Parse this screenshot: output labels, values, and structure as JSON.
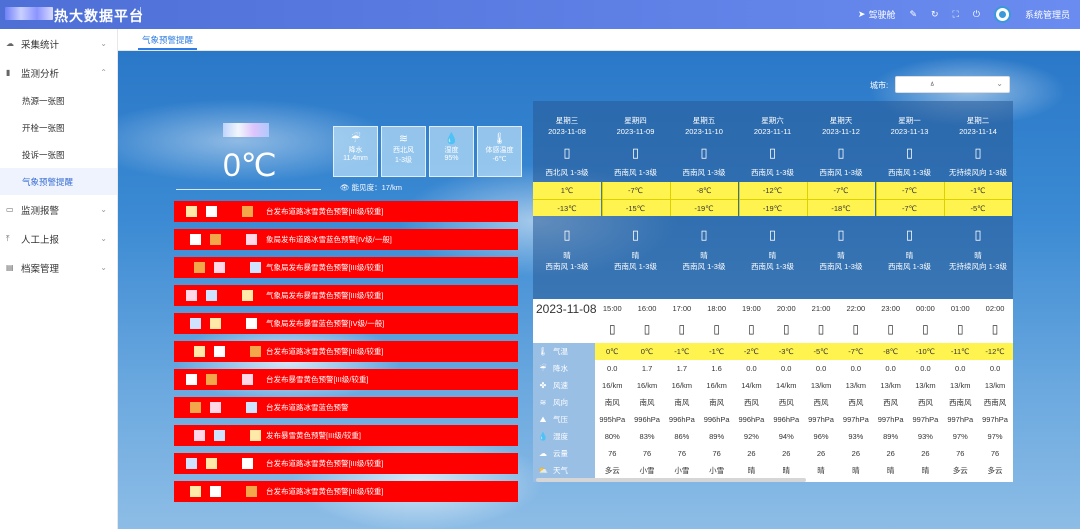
{
  "header": {
    "title": "热大数据平台",
    "actions": [
      {
        "icon": "send-icon",
        "label": "驾驶舱"
      },
      {
        "icon": "edit-icon",
        "label": ""
      },
      {
        "icon": "refresh-icon",
        "label": ""
      },
      {
        "icon": "fullscreen-icon",
        "label": ""
      },
      {
        "icon": "power-icon",
        "label": ""
      }
    ],
    "user": "系统管理员"
  },
  "sidebar": {
    "groups": [
      {
        "label": "采集统计",
        "icon": "cloud-icon",
        "expanded": false
      },
      {
        "label": "监测分析",
        "icon": "bar-chart-icon",
        "expanded": true,
        "items": [
          "热源一张图",
          "开栓一张图",
          "投诉一张图",
          "气象预警提醒"
        ]
      },
      {
        "label": "监测报警",
        "icon": "monitor-icon",
        "expanded": false
      },
      {
        "label": "人工上报",
        "icon": "upload-icon",
        "expanded": false
      },
      {
        "label": "档案管理",
        "icon": "archive-icon",
        "expanded": false
      }
    ],
    "active_item": "气象预警提醒"
  },
  "tabs": [
    "气象预警提醒"
  ],
  "city": {
    "label": "城市:",
    "value": "ㅿ"
  },
  "current": {
    "temp": "0℃",
    "cards": [
      {
        "icon": "rain-icon",
        "label": "降水",
        "value": "11.4mm"
      },
      {
        "icon": "wind-icon",
        "label": "西北风",
        "value": "1-3级"
      },
      {
        "icon": "humidity-icon",
        "label": "湿度",
        "value": "95%"
      },
      {
        "icon": "thermometer-icon",
        "label": "体感温度",
        "value": "-6℃"
      }
    ],
    "visibility": "能见度：17/km"
  },
  "alerts": [
    "台发布道路冰雪黄色预警[III级/较重]",
    "象局发布道路冰雪蓝色预警[IV级/一般]",
    "气象局发布暴雪黄色预警[III级/较重]",
    "气象局发布暴雪黄色预警[III级/较重]",
    "气象局发布暴雪蓝色预警[IV级/一般]",
    "台发布道路冰雪黄色预警[III级/较重]",
    "台发布暴雪黄色预警[III级/较重]",
    "台发布道路冰雪蓝色预警",
    "发布暴雪黄色预警[III级/较重]",
    "台发布道路冰雪黄色预警[III级/较重]",
    "台发布道路冰雪黄色预警[III级/较重]"
  ],
  "forecast": [
    {
      "day": "星期三",
      "date": "2023-11-08",
      "wind1": "西北风 1-3级",
      "hi": "1℃",
      "lo": "-13℃",
      "cond2": "晴",
      "wind2": "西南风 1-3级"
    },
    {
      "day": "星期四",
      "date": "2023-11-09",
      "wind1": "西南风 1-3级",
      "hi": "-7℃",
      "lo": "-15℃",
      "cond2": "晴",
      "wind2": "西南风 1-3级"
    },
    {
      "day": "星期五",
      "date": "2023-11-10",
      "wind1": "西南风 1-3级",
      "hi": "-8℃",
      "lo": "-19℃",
      "cond2": "晴",
      "wind2": "西南风 1-3级"
    },
    {
      "day": "星期六",
      "date": "2023-11-11",
      "wind1": "西南风 1-3级",
      "hi": "-12℃",
      "lo": "-19℃",
      "cond2": "晴",
      "wind2": "西南风 1-3级"
    },
    {
      "day": "星期天",
      "date": "2023-11-12",
      "wind1": "西南风 1-3级",
      "hi": "-7℃",
      "lo": "-18℃",
      "cond2": "晴",
      "wind2": "西南风 1-3级"
    },
    {
      "day": "星期一",
      "date": "2023-11-13",
      "wind1": "西南风 1-3级",
      "hi": "-7℃",
      "lo": "-7℃",
      "cond2": "晴",
      "wind2": "西南风 1-3级"
    },
    {
      "day": "星期二",
      "date": "2023-11-14",
      "wind1": "无持续风向 1-3级",
      "hi": "-1℃",
      "lo": "-5℃",
      "cond2": "晴",
      "wind2": "无持续风向 1-3级"
    }
  ],
  "hourly": {
    "date": "2023-11-08",
    "row_labels": [
      {
        "icon": "thermometer-icon",
        "label": "气温"
      },
      {
        "icon": "rain-icon",
        "label": "降水"
      },
      {
        "icon": "fan-icon",
        "label": "风速"
      },
      {
        "icon": "wind-icon",
        "label": "风向"
      },
      {
        "icon": "pressure-icon",
        "label": "气压"
      },
      {
        "icon": "humidity-icon",
        "label": "湿度"
      },
      {
        "icon": "cloud-icon",
        "label": "云量"
      },
      {
        "icon": "weather-icon",
        "label": "天气"
      }
    ],
    "hours": [
      {
        "time": "15:00",
        "temp": "0℃",
        "rain": "0.0",
        "speed": "16/km",
        "dir": "南风",
        "pres": "995hPa",
        "hum": "80%",
        "cloud": "76",
        "wx": "多云"
      },
      {
        "time": "16:00",
        "temp": "0℃",
        "rain": "1.7",
        "speed": "16/km",
        "dir": "南风",
        "pres": "996hPa",
        "hum": "83%",
        "cloud": "76",
        "wx": "小雪"
      },
      {
        "time": "17:00",
        "temp": "-1℃",
        "rain": "1.7",
        "speed": "16/km",
        "dir": "南风",
        "pres": "996hPa",
        "hum": "86%",
        "cloud": "76",
        "wx": "小雪"
      },
      {
        "time": "18:00",
        "temp": "-1℃",
        "rain": "1.6",
        "speed": "16/km",
        "dir": "南风",
        "pres": "996hPa",
        "hum": "89%",
        "cloud": "76",
        "wx": "小雪"
      },
      {
        "time": "19:00",
        "temp": "-2℃",
        "rain": "0.0",
        "speed": "14/km",
        "dir": "西风",
        "pres": "996hPa",
        "hum": "92%",
        "cloud": "26",
        "wx": "晴"
      },
      {
        "time": "20:00",
        "temp": "-3℃",
        "rain": "0.0",
        "speed": "14/km",
        "dir": "西风",
        "pres": "996hPa",
        "hum": "94%",
        "cloud": "26",
        "wx": "晴"
      },
      {
        "time": "21:00",
        "temp": "-5℃",
        "rain": "0.0",
        "speed": "13/km",
        "dir": "西风",
        "pres": "997hPa",
        "hum": "96%",
        "cloud": "26",
        "wx": "晴"
      },
      {
        "time": "22:00",
        "temp": "-7℃",
        "rain": "0.0",
        "speed": "13/km",
        "dir": "西风",
        "pres": "997hPa",
        "hum": "93%",
        "cloud": "26",
        "wx": "晴"
      },
      {
        "time": "23:00",
        "temp": "-8℃",
        "rain": "0.0",
        "speed": "13/km",
        "dir": "西风",
        "pres": "997hPa",
        "hum": "89%",
        "cloud": "26",
        "wx": "晴"
      },
      {
        "time": "00:00",
        "temp": "-10℃",
        "rain": "0.0",
        "speed": "13/km",
        "dir": "西风",
        "pres": "997hPa",
        "hum": "93%",
        "cloud": "26",
        "wx": "晴"
      },
      {
        "time": "01:00",
        "temp": "-11℃",
        "rain": "0.0",
        "speed": "13/km",
        "dir": "西南风",
        "pres": "997hPa",
        "hum": "97%",
        "cloud": "76",
        "wx": "多云"
      },
      {
        "time": "02:00",
        "temp": "-12℃",
        "rain": "0.0",
        "speed": "13/km",
        "dir": "西南风",
        "pres": "997hPa",
        "hum": "97%",
        "cloud": "76",
        "wx": "多云"
      }
    ]
  },
  "colors": {
    "header": "#4e6fd6",
    "accent": "#2f7de1",
    "alert": "#ff0000",
    "highlight": "#fff44f"
  }
}
